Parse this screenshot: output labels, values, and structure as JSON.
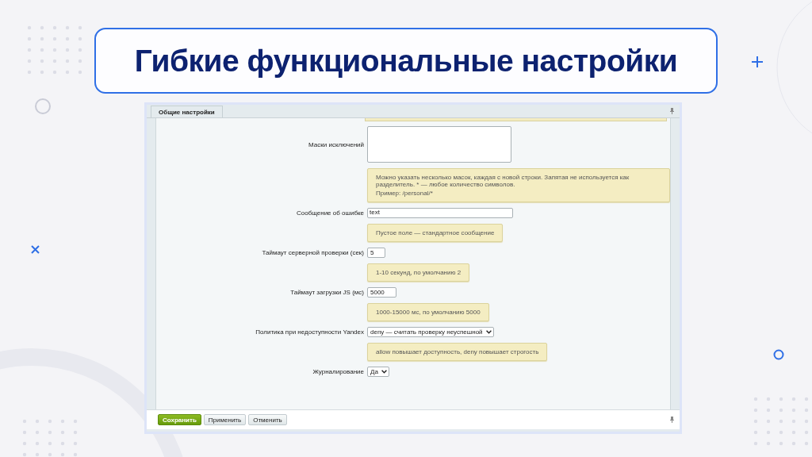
{
  "title": "Гибкие функциональные настройки",
  "tabs": [
    {
      "label": "Общие настройки"
    }
  ],
  "rows": [
    {
      "kind": "textarea",
      "label": "Маски исключений"
    },
    {
      "kind": "hint",
      "lines": [
        "Можно указать несколько масок, каждая с новой строки. Запятая не используется как разделитель. * — любое количество символов.",
        "Пример: /personal/*"
      ]
    },
    {
      "kind": "textline",
      "label": "Сообщение об ошибке",
      "value": "text"
    },
    {
      "kind": "hint",
      "lines": [
        "Пустое поле — стандартное сообщение"
      ]
    },
    {
      "kind": "input",
      "label": "Таймаут серверной проверки (сек)",
      "value": "5"
    },
    {
      "kind": "hint",
      "lines": [
        "1-10 секунд, по умолчанию 2"
      ]
    },
    {
      "kind": "input",
      "label": "Таймаут загрузки JS (мс)",
      "value": "5000"
    },
    {
      "kind": "hint",
      "lines": [
        "1000-15000 мс, по умолчанию 5000"
      ]
    },
    {
      "kind": "select",
      "label": "Политика при недоступности Yandex",
      "value": "deny — считать проверку неуспешной"
    },
    {
      "kind": "hint",
      "lines": [
        "allow повышает доступность, deny повышает строгость"
      ]
    },
    {
      "kind": "select",
      "label": "Журналирование",
      "value": "Да"
    }
  ],
  "buttons": [
    {
      "label": "Сохранить",
      "kind": "primary"
    },
    {
      "label": "Применить",
      "kind": "normal"
    },
    {
      "label": "Отменить",
      "kind": "normal"
    }
  ]
}
